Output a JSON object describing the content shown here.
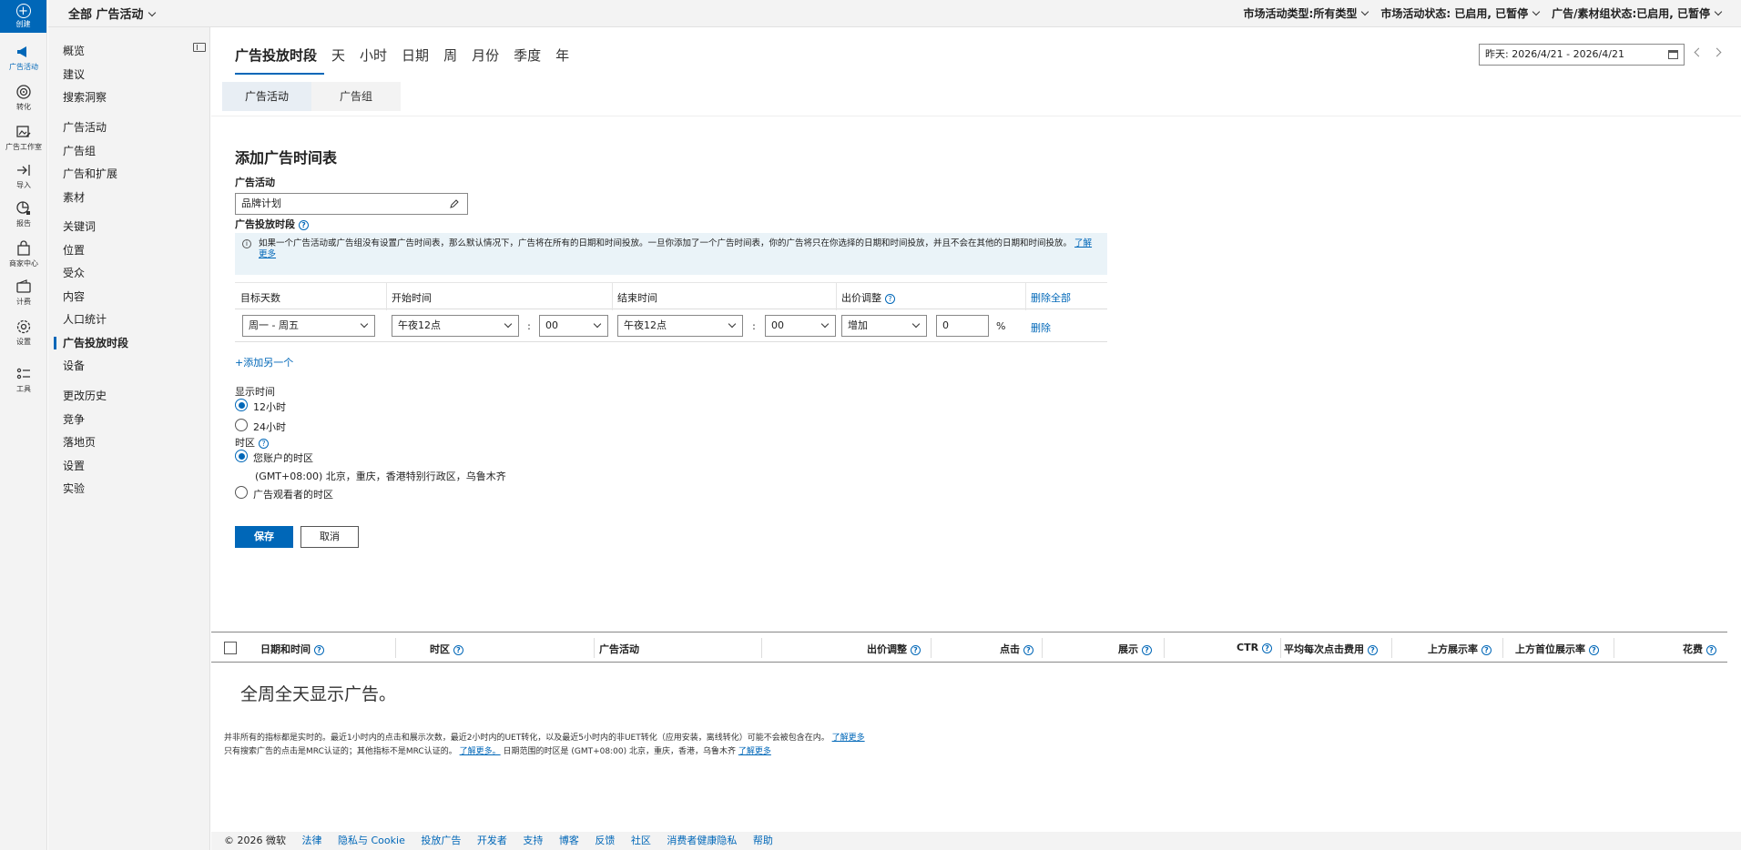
{
  "rail": {
    "create": "创建",
    "items": [
      "广告活动",
      "转化",
      "广告工作室",
      "导入",
      "报告",
      "商家中心",
      "计费",
      "设置",
      "工具"
    ]
  },
  "topbar": {
    "scope": "全部 广告活动",
    "filters": [
      "市场活动类型:所有类型",
      "市场活动状态: 已启用, 已暂停",
      "广告/素材组状态:已启用, 已暂停"
    ]
  },
  "leftnav": {
    "items": [
      "概览",
      "建议",
      "搜索洞察",
      "广告活动",
      "广告组",
      "广告和扩展",
      "素材",
      "关键词",
      "位置",
      "受众",
      "内容",
      "人口统计",
      "广告投放时段",
      "设备",
      "更改历史",
      "竞争",
      "落地页",
      "设置",
      "实验"
    ]
  },
  "tabs": [
    "广告投放时段",
    "天",
    "小时",
    "日期",
    "周",
    "月份",
    "季度",
    "年"
  ],
  "date_range": "昨天: 2026/4/21 - 2026/4/21",
  "subtabs": [
    "广告活动",
    "广告组"
  ],
  "form": {
    "title": "添加广告时间表",
    "campaign_label": "广告活动",
    "campaign_value": "品牌计划",
    "schedule_label": "广告投放时段",
    "info_text": "如果一个广告活动或广告组没有设置广告时间表，那么默认情况下，广告将在所有的日期和时间投放。一旦你添加了一个广告时间表，你的广告将只在你选择的日期和时间投放，并且不会在其他的日期和时间投放。",
    "info_link": "了解更多",
    "columns": [
      "目标天数",
      "开始时间",
      "结束时间",
      "出价调整"
    ],
    "delete_all": "删除全部",
    "row": {
      "days": "周一 - 周五",
      "start_hour": "午夜12点",
      "start_min": "00",
      "end_hour": "午夜12点",
      "end_min": "00",
      "adjust_type": "增加",
      "adjust_value": "0",
      "percent": "%",
      "delete": "删除"
    },
    "add_another": "+添加另一个",
    "display_time_label": "显示时间",
    "display_12h": "12小时",
    "display_24h": "24小时",
    "tz_label": "时区",
    "tz_account": "您账户的时区",
    "tz_account_detail": "(GMT+08:00) 北京，重庆，香港特别行政区，乌鲁木齐",
    "tz_viewer": "广告观看者的时区",
    "save": "保存",
    "cancel": "取消"
  },
  "grid": {
    "columns": [
      "日期和时间",
      "时区",
      "广告活动",
      "出价调整",
      "点击",
      "展示",
      "CTR",
      "平均每次点击费用",
      "上方展示率",
      "上方首位展示率",
      "花费"
    ],
    "empty": "全周全天显示广告。"
  },
  "footnotes": {
    "line1": "并非所有的指标都是实时的。最近1小时内的点击和展示次数，最近2小时内的UET转化，以及最近5小时内的非UET转化（应用安装，离线转化）可能不会被包含在内。",
    "line1_link": "了解更多",
    "line2": "只有搜索广告的点击是MRC认证的；其他指标不是MRC认证的。",
    "line2_link": "了解更多。",
    "line2_tail": "日期范围的时区是 (GMT+08:00) 北京，重庆，香港，乌鲁木齐",
    "line2_link2": "了解更多"
  },
  "footer": {
    "copyright": "© 2026 微软",
    "links": [
      "法律",
      "隐私与 Cookie",
      "投放广告",
      "开发者",
      "支持",
      "博客",
      "反馈",
      "社区",
      "消费者健康隐私",
      "帮助"
    ]
  }
}
